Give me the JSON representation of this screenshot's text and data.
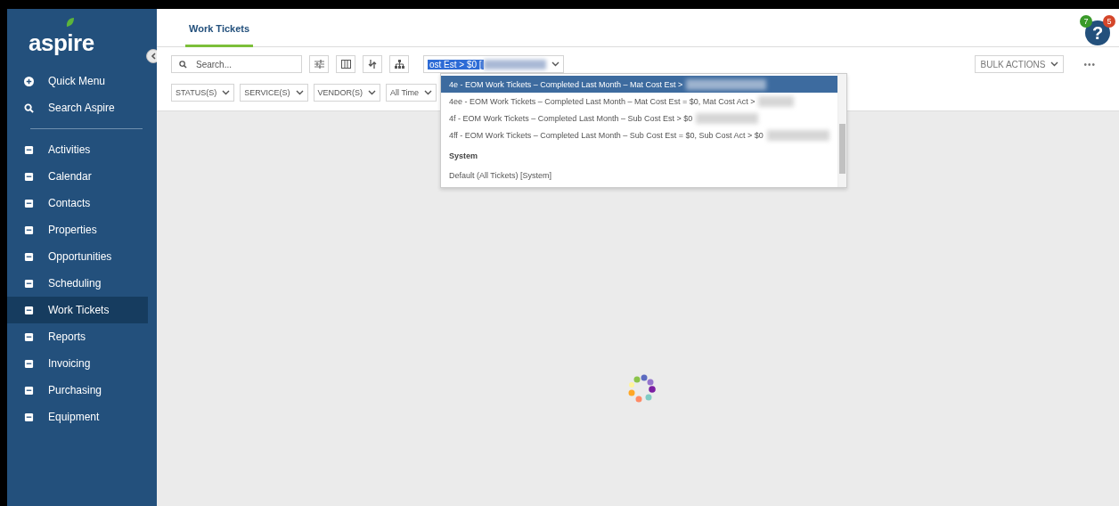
{
  "sidebar": {
    "logo": "aspire",
    "top_items": [
      {
        "label": "Quick Menu"
      },
      {
        "label": "Search Aspire"
      }
    ],
    "items": [
      {
        "label": "Activities",
        "selected": false
      },
      {
        "label": "Calendar",
        "selected": false
      },
      {
        "label": "Contacts",
        "selected": false
      },
      {
        "label": "Properties",
        "selected": false
      },
      {
        "label": "Opportunities",
        "selected": false
      },
      {
        "label": "Scheduling",
        "selected": false
      },
      {
        "label": "Work Tickets",
        "selected": true
      },
      {
        "label": "Reports",
        "selected": false
      },
      {
        "label": "Invoicing",
        "selected": false
      },
      {
        "label": "Purchasing",
        "selected": false
      },
      {
        "label": "Equipment",
        "selected": false
      }
    ]
  },
  "header": {
    "tabs": [
      {
        "label": "Work Tickets",
        "selected": true
      }
    ],
    "help_label": "?",
    "help_badges": [
      {
        "count": "7",
        "color": "#3a9a2a"
      },
      {
        "count": "5",
        "color": "#d4462a"
      }
    ]
  },
  "toolbar": {
    "search": {
      "placeholder": "Search..."
    },
    "view_select": {
      "value": "ost Est > $0 ["
    },
    "bulk_actions": "BULK ACTIONS",
    "more": "•••"
  },
  "filters": [
    {
      "label": "STATUS(S)"
    },
    {
      "label": "SERVICE(S)"
    },
    {
      "label": "VENDOR(S)"
    },
    {
      "label": "All Time"
    }
  ],
  "dropdown": {
    "options": [
      {
        "kind": "option",
        "label": "4e - EOM Work Tickets – Completed Last Month – Mat Cost Est >",
        "redacted": true,
        "selected": true
      },
      {
        "kind": "option",
        "label": "4ee - EOM Work Tickets – Completed Last Month – Mat Cost Est = $0, Mat Cost Act >",
        "redacted": true,
        "selected": false
      },
      {
        "kind": "option",
        "label": "4f - EOM Work Tickets – Completed Last Month – Sub Cost Est > $0",
        "redacted": true,
        "selected": false
      },
      {
        "kind": "option",
        "label": "4ff - EOM Work Tickets – Completed Last Month – Sub Cost Est = $0, Sub Cost Act > $0",
        "redacted": true,
        "selected": false
      },
      {
        "kind": "group",
        "label": "System"
      },
      {
        "kind": "option",
        "label": "Default (All Tickets) [System]",
        "redacted": false,
        "selected": false
      }
    ]
  }
}
